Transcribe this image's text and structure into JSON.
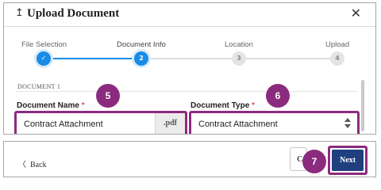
{
  "dialog": {
    "title": "Upload Document",
    "title_icon": "upload-icon",
    "close_glyph": "✕",
    "accent_color": "#1a8be6",
    "annotation_color": "#8b2b7d"
  },
  "stepper": {
    "steps": [
      {
        "label": "File Selection",
        "marker": "✓",
        "state": "complete"
      },
      {
        "label": "Document Info",
        "marker": "2",
        "state": "active"
      },
      {
        "label": "Location",
        "marker": "3",
        "state": "pending"
      },
      {
        "label": "Upload",
        "marker": "4",
        "state": "pending"
      }
    ]
  },
  "document": {
    "section_label": "DOCUMENT 1",
    "name_label": "Document Name",
    "name_required": "*",
    "name_value": "Contract Attachment",
    "name_extension": ".pdf",
    "type_label": "Document Type",
    "type_required": "*",
    "type_value": "Contract Attachment"
  },
  "callouts": [
    "5",
    "6",
    "7"
  ],
  "footer": {
    "back_chevron": "〈",
    "back_label": "Back",
    "partial_button_label": "C",
    "next_label": "Next"
  }
}
